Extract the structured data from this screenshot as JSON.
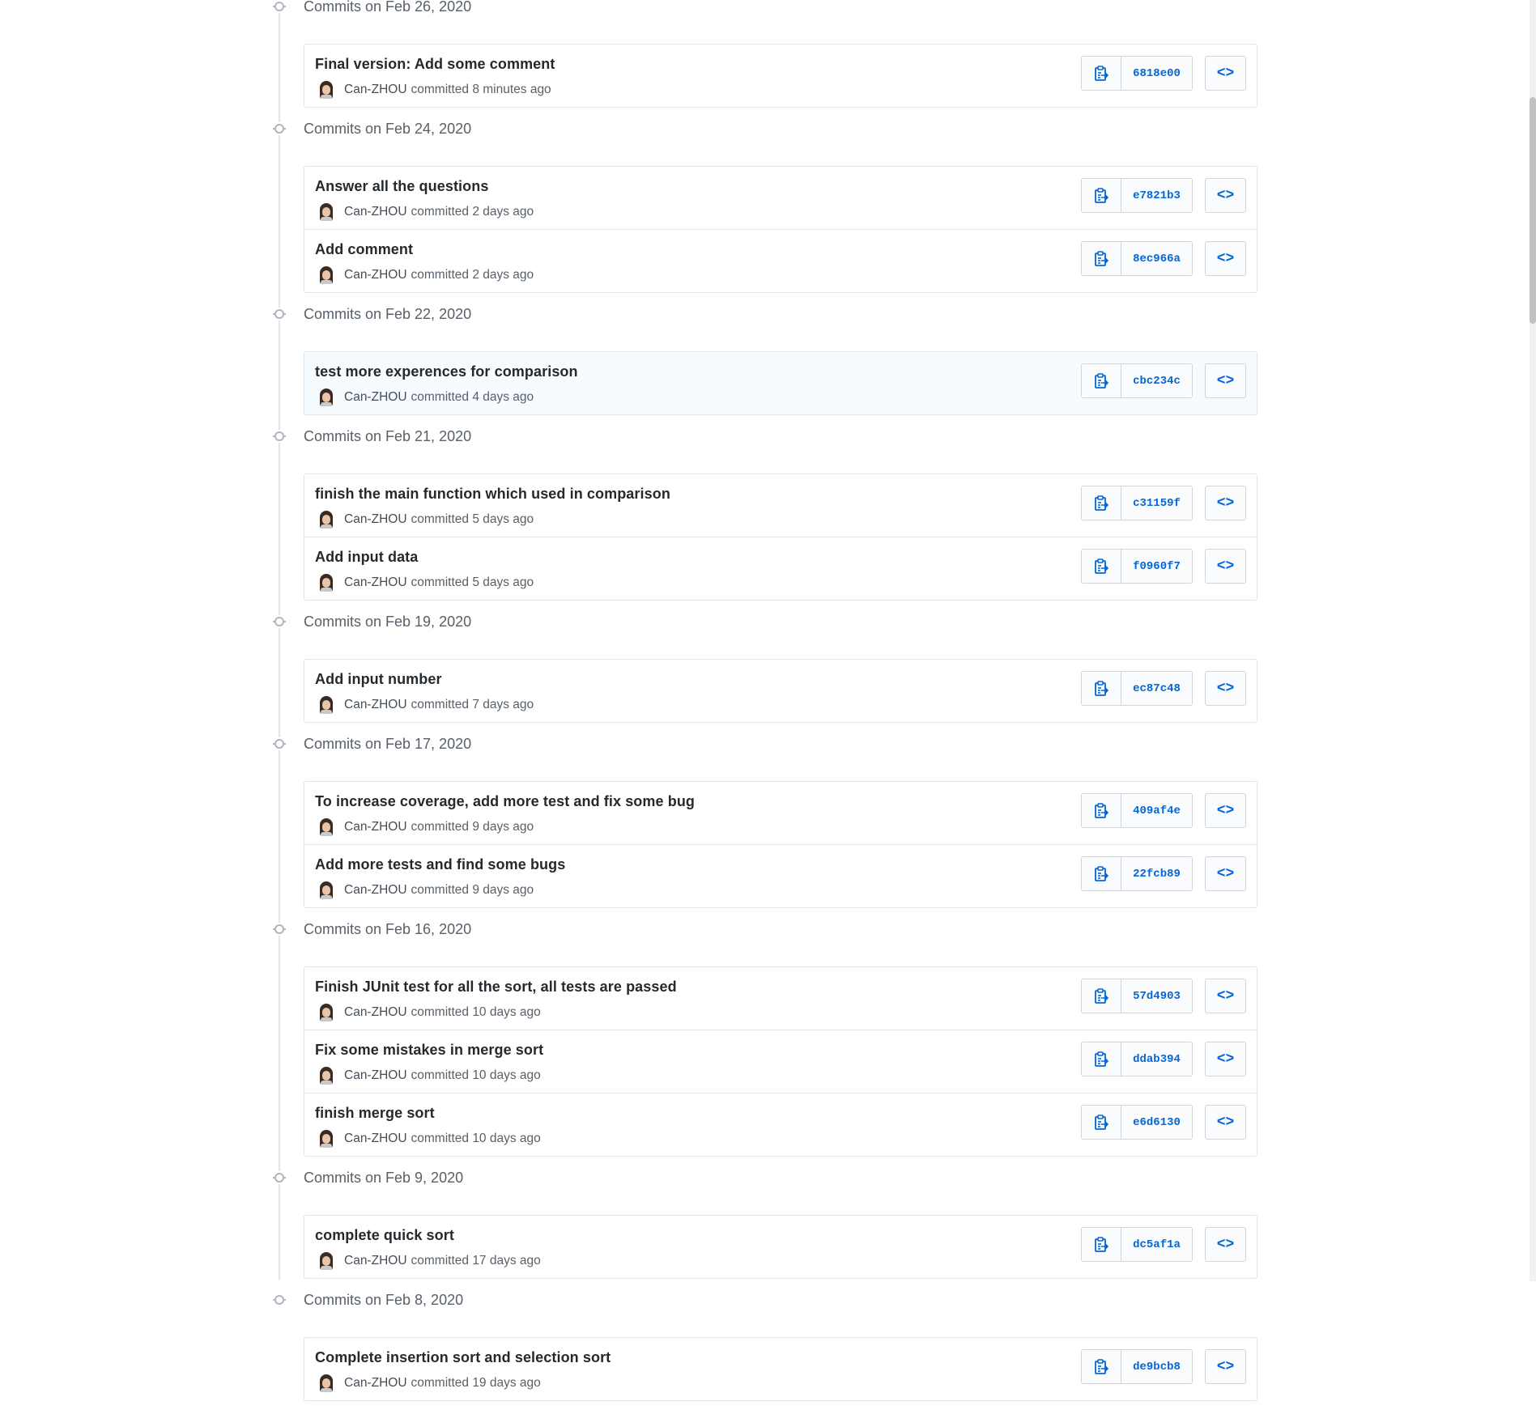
{
  "colors": {
    "link": "#0366d6",
    "muted": "#586069",
    "border": "#e1e4e8",
    "highlight": "#f6fbff"
  },
  "icons": {
    "copy": "clipboard-icon",
    "browse": "code-icon",
    "node": "commit-node-icon"
  },
  "browse_glyph": "<>",
  "groups": [
    {
      "date": "Commits on Feb 26, 2020",
      "commits": [
        {
          "title": "Final version: Add some comment",
          "author": "Can-ZHOU",
          "time": "committed 8 minutes ago",
          "sha": "6818e00",
          "highlighted": false
        }
      ]
    },
    {
      "date": "Commits on Feb 24, 2020",
      "commits": [
        {
          "title": "Answer all the questions",
          "author": "Can-ZHOU",
          "time": "committed 2 days ago",
          "sha": "e7821b3",
          "highlighted": false
        },
        {
          "title": "Add comment",
          "author": "Can-ZHOU",
          "time": "committed 2 days ago",
          "sha": "8ec966a",
          "highlighted": false
        }
      ]
    },
    {
      "date": "Commits on Feb 22, 2020",
      "commits": [
        {
          "title": "test more experences for comparison",
          "author": "Can-ZHOU",
          "time": "committed 4 days ago",
          "sha": "cbc234c",
          "highlighted": true
        }
      ]
    },
    {
      "date": "Commits on Feb 21, 2020",
      "commits": [
        {
          "title": "finish the main function which used in comparison",
          "author": "Can-ZHOU",
          "time": "committed 5 days ago",
          "sha": "c31159f",
          "highlighted": false
        },
        {
          "title": "Add input data",
          "author": "Can-ZHOU",
          "time": "committed 5 days ago",
          "sha": "f0960f7",
          "highlighted": false
        }
      ]
    },
    {
      "date": "Commits on Feb 19, 2020",
      "commits": [
        {
          "title": "Add input number",
          "author": "Can-ZHOU",
          "time": "committed 7 days ago",
          "sha": "ec87c48",
          "highlighted": false
        }
      ]
    },
    {
      "date": "Commits on Feb 17, 2020",
      "commits": [
        {
          "title": "To increase coverage, add more test and fix some bug",
          "author": "Can-ZHOU",
          "time": "committed 9 days ago",
          "sha": "409af4e",
          "highlighted": false
        },
        {
          "title": "Add more tests and find some bugs",
          "author": "Can-ZHOU",
          "time": "committed 9 days ago",
          "sha": "22fcb89",
          "highlighted": false
        }
      ]
    },
    {
      "date": "Commits on Feb 16, 2020",
      "commits": [
        {
          "title": "Finish JUnit test for all the sort, all tests are passed",
          "author": "Can-ZHOU",
          "time": "committed 10 days ago",
          "sha": "57d4903",
          "highlighted": false
        },
        {
          "title": "Fix some mistakes in merge sort",
          "author": "Can-ZHOU",
          "time": "committed 10 days ago",
          "sha": "ddab394",
          "highlighted": false
        },
        {
          "title": "finish merge sort",
          "author": "Can-ZHOU",
          "time": "committed 10 days ago",
          "sha": "e6d6130",
          "highlighted": false
        }
      ]
    },
    {
      "date": "Commits on Feb 9, 2020",
      "commits": [
        {
          "title": "complete quick sort",
          "author": "Can-ZHOU",
          "time": "committed 17 days ago",
          "sha": "dc5af1a",
          "highlighted": false
        }
      ]
    },
    {
      "date": "Commits on Feb 8, 2020",
      "commits": [
        {
          "title": "Complete insertion sort and selection sort",
          "author": "Can-ZHOU",
          "time": "committed 19 days ago",
          "sha": "de9bcb8",
          "highlighted": false
        }
      ]
    }
  ]
}
